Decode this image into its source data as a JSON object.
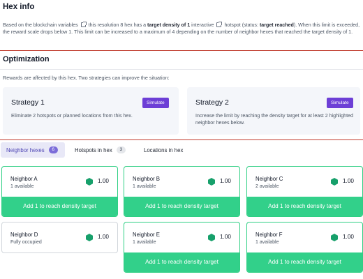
{
  "hex_info": {
    "title": "Hex info",
    "desc_1": "Based on the blockchain variables",
    "desc_2": "this resolution 8 hex has a",
    "desc_3": "target density of 1",
    "desc_4": "interactive",
    "desc_5": "hotspot (status:",
    "desc_6": "target reached",
    "desc_7": "). When this limit is exceeded, the reward scale drops below 1. This limit can be increased to a maximum of 4 depending on the number of neighbor hexes that reached the target density of 1."
  },
  "optimization": {
    "title": "Optimization",
    "description": "Rewards are affected by this hex. Two strategies can improve the situation:",
    "strategies": [
      {
        "title": "Strategy 1",
        "button": "Simulate",
        "description": "Eliminate 2 hotspots or planned locations from this hex."
      },
      {
        "title": "Strategy 2",
        "button": "Simulate",
        "description": "Increase the limit by reaching the density target for at least 2 highlighted neighbor hexes below."
      }
    ]
  },
  "tabs": [
    {
      "label": "Neighbor hexes",
      "count": "6"
    },
    {
      "label": "Hotspots in hex",
      "count": "3"
    },
    {
      "label": "Locations in hex",
      "count": ""
    }
  ],
  "neighbors": [
    {
      "name": "Neighbor A",
      "status": "1 available",
      "score": "1.00",
      "action": "Add 1 to reach density target"
    },
    {
      "name": "Neighbor B",
      "status": "1 available",
      "score": "1.00",
      "action": "Add 1 to reach density target"
    },
    {
      "name": "Neighbor C",
      "status": "2 available",
      "score": "1.00",
      "action": "Add 1 to reach density target"
    },
    {
      "name": "Neighbor D",
      "status": "Fully occupied",
      "score": "1.00",
      "action": ""
    },
    {
      "name": "Neighbor E",
      "status": "1 available",
      "score": "1.00",
      "action": "Add 1 to reach density target"
    },
    {
      "name": "Neighbor F",
      "status": "1 available",
      "score": "1.00",
      "action": "Add 1 to reach density target"
    }
  ],
  "colors": {
    "accent_purple": "#6d3fd6",
    "success_green": "#32d08a",
    "hex_green": "#17a06b",
    "divider_red": "#c0392b"
  },
  "icons": {
    "external_link": "external-link-icon",
    "hex": "hex-icon"
  }
}
